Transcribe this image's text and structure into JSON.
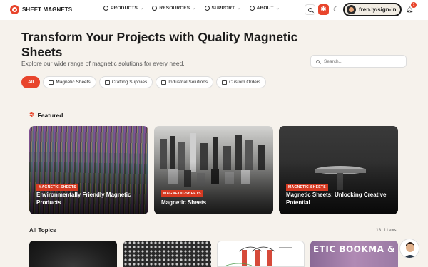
{
  "brand": {
    "name": "SHEET MAGNETS",
    "accent": "#e8452c"
  },
  "nav": {
    "items": [
      {
        "label": "PRODUCTS",
        "icon": "compass-icon"
      },
      {
        "label": "RESOURCES",
        "icon": "compass-icon"
      },
      {
        "label": "SUPPORT",
        "icon": "compass-icon"
      },
      {
        "label": "ABOUT",
        "icon": "compass-icon"
      }
    ],
    "signin_label": "fren.ly/sign-in",
    "notification_count": "1"
  },
  "hero": {
    "title": "Transform Your Projects with Quality Magnetic Sheets",
    "subtitle": "Explore our wide range of magnetic solutions for every need.",
    "search_placeholder": "Search...",
    "filters": [
      {
        "label": "All",
        "active": true
      },
      {
        "label": "Magnetic Sheets",
        "icon": "box-icon"
      },
      {
        "label": "Crafting Supplies",
        "icon": "box-icon"
      },
      {
        "label": "Industrial Solutions",
        "icon": "box-icon"
      },
      {
        "label": "Custom Orders",
        "icon": "box-icon"
      }
    ]
  },
  "featured": {
    "heading": "Featured",
    "cards": [
      {
        "badge": "MAGNETIC-SHEETS",
        "title": "Environmentally Friendly Magnetic Products"
      },
      {
        "badge": "MAGNETIC-SHEETS",
        "title": "Magnetic Sheets"
      },
      {
        "badge": "MAGNETIC-SHEETS",
        "title": "Magnetic Sheets: Unlocking Creative Potential"
      }
    ]
  },
  "topics": {
    "heading": "All Topics",
    "count": "18 items",
    "thumb4_text": "ETIC BOOKMA & REF MAGNETS"
  }
}
